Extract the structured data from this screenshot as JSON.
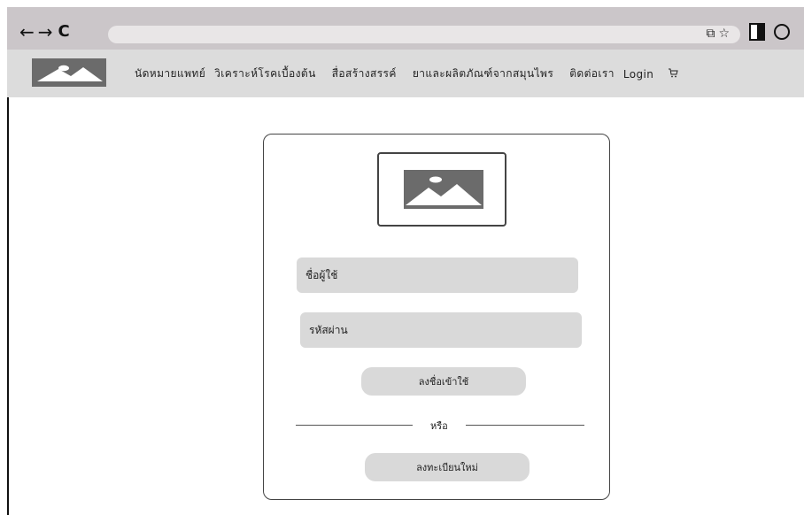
{
  "browser": {
    "back": "←",
    "forward": "→",
    "reload": "C",
    "share_icon": "⧉",
    "star_icon": "☆",
    "menu_icon": "⋮"
  },
  "site_nav": {
    "items": [
      {
        "label": "นัดหมายแพทย์"
      },
      {
        "label": "วิเคราะห์โรคเบื้องต้น"
      },
      {
        "label": "สื่อสร้างสรรค์"
      },
      {
        "label": "ยาและผลิตภัณฑ์จากสมุนไพร"
      },
      {
        "label": "ติดต่อเรา"
      },
      {
        "label": "Login"
      }
    ],
    "cart_icon": "🛒"
  },
  "login": {
    "username_placeholder": "ชื่อผู้ใช้",
    "password_placeholder": "รหัสผ่าน",
    "login_button": "ลงชื่อเข้าใช้",
    "or_text": "หรือ",
    "register_button": "ลงทะเบียนใหม่"
  }
}
